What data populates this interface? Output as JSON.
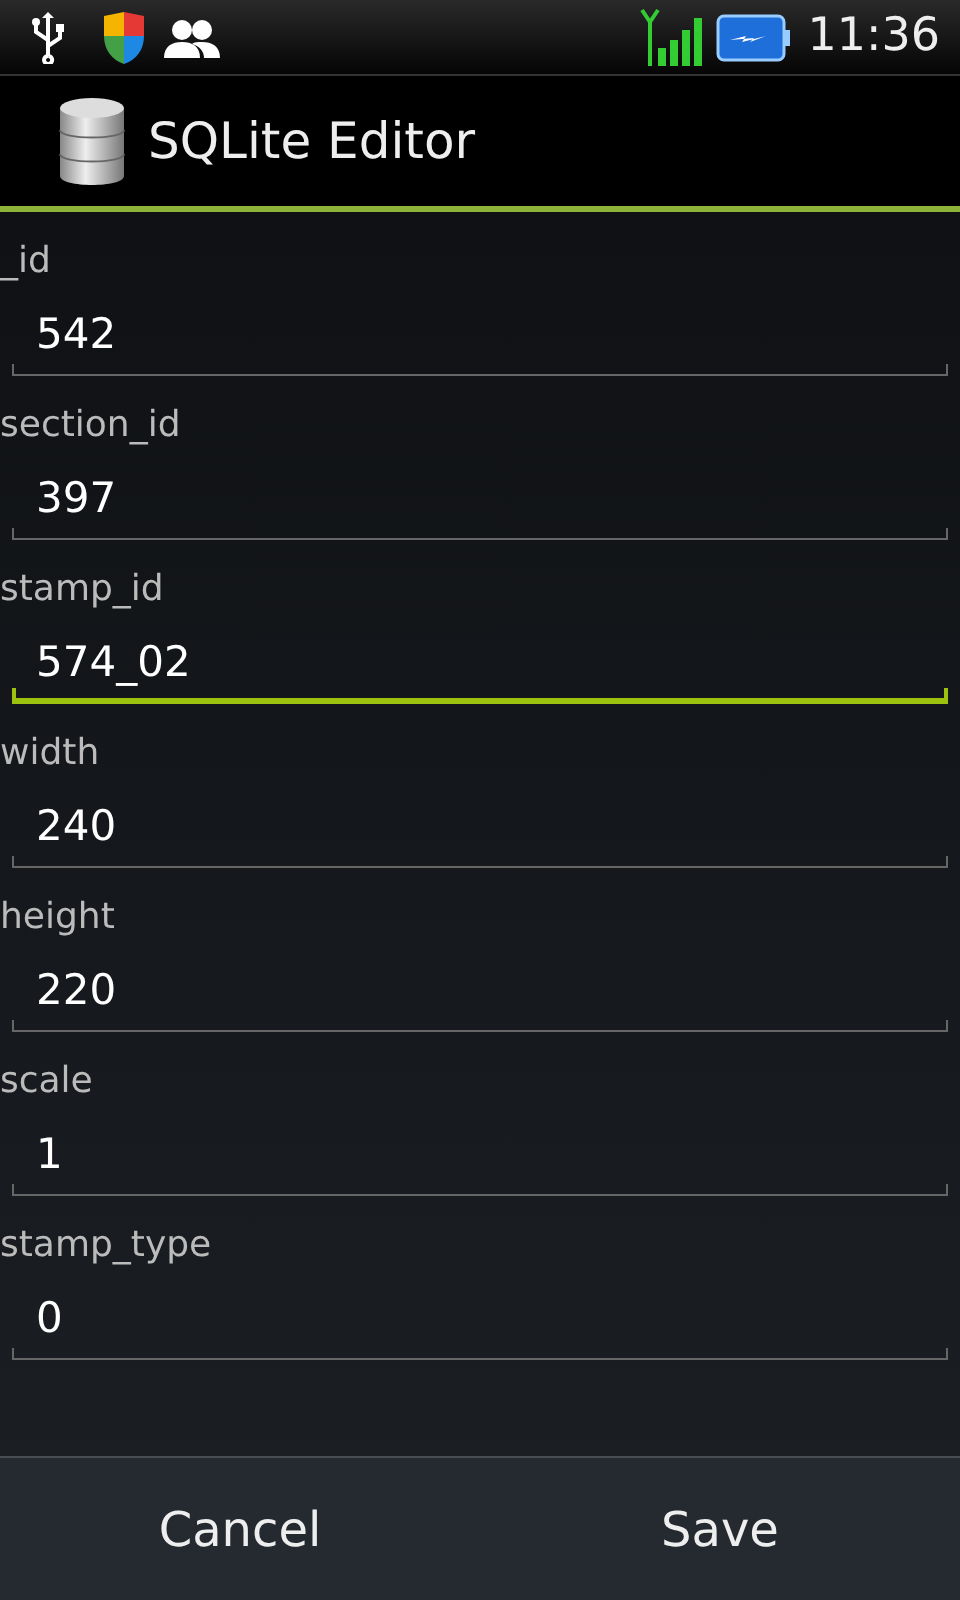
{
  "status_bar": {
    "time": "11:36"
  },
  "app_bar": {
    "title": "SQLite Editor"
  },
  "fields": [
    {
      "label": "_id",
      "value": "542",
      "focused": false
    },
    {
      "label": "section_id",
      "value": "397",
      "focused": false
    },
    {
      "label": "stamp_id",
      "value": "574_02",
      "focused": true
    },
    {
      "label": "width",
      "value": "240",
      "focused": false
    },
    {
      "label": "height",
      "value": "220",
      "focused": false
    },
    {
      "label": "scale",
      "value": "1",
      "focused": false
    },
    {
      "label": "stamp_type",
      "value": "0",
      "focused": false
    }
  ],
  "buttons": [
    "Cancel",
    "Save"
  ]
}
